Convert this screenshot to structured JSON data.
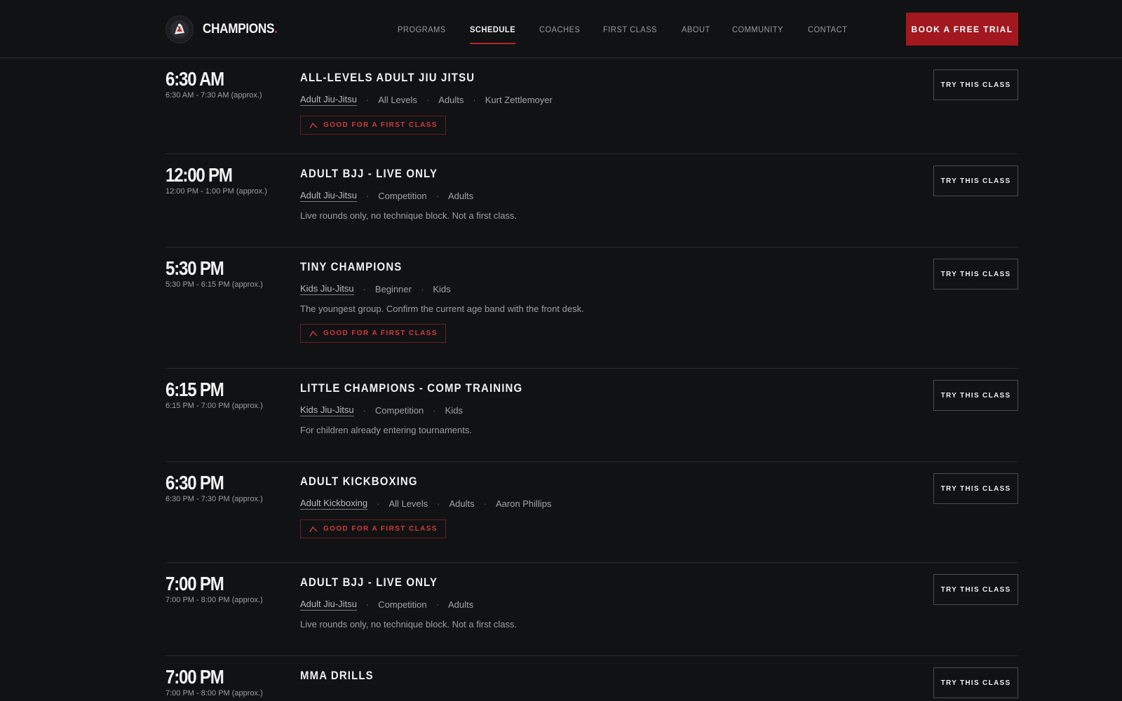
{
  "header": {
    "brand": "CHAMPIONS",
    "brand_dot": ".",
    "nav": [
      "PROGRAMS",
      "SCHEDULE",
      "COACHES",
      "FIRST CLASS",
      "ABOUT",
      "COMMUNITY",
      "CONTACT"
    ],
    "active_nav": "SCHEDULE",
    "cta": "BOOK A FREE TRIAL"
  },
  "colors": {
    "accent": "#a3181f",
    "badge": "#d13b3d",
    "background": "#111214"
  },
  "badge_label": "GOOD FOR A FIRST CLASS",
  "try_label": "TRY THIS CLASS",
  "classes": [
    {
      "time": "6:30 AM",
      "range": "6:30 AM - 7:30 AM (approx.)",
      "title": "ALL-LEVELS ADULT JIU JITSU",
      "program": "Adult Jiu-Jitsu",
      "tags": [
        "All Levels",
        "Adults",
        "Kurt Zettlemoyer"
      ],
      "description": "",
      "first_class": true
    },
    {
      "time": "12:00 PM",
      "range": "12:00 PM - 1:00 PM (approx.)",
      "title": "ADULT BJJ - LIVE ONLY",
      "program": "Adult Jiu-Jitsu",
      "tags": [
        "Competition",
        "Adults"
      ],
      "description": "Live rounds only, no technique block. Not a first class.",
      "first_class": false
    },
    {
      "time": "5:30 PM",
      "range": "5:30 PM - 6:15 PM (approx.)",
      "title": "TINY CHAMPIONS",
      "program": "Kids Jiu-Jitsu",
      "tags": [
        "Beginner",
        "Kids"
      ],
      "description": "The youngest group. Confirm the current age band with the front desk.",
      "first_class": true
    },
    {
      "time": "6:15 PM",
      "range": "6:15 PM - 7:00 PM (approx.)",
      "title": "LITTLE CHAMPIONS - COMP TRAINING",
      "program": "Kids Jiu-Jitsu",
      "tags": [
        "Competition",
        "Kids"
      ],
      "description": "For children already entering tournaments.",
      "first_class": false
    },
    {
      "time": "6:30 PM",
      "range": "6:30 PM - 7:30 PM (approx.)",
      "title": "ADULT KICKBOXING",
      "program": "Adult Kickboxing",
      "tags": [
        "All Levels",
        "Adults",
        "Aaron Phillips"
      ],
      "description": "",
      "first_class": true
    },
    {
      "time": "7:00 PM",
      "range": "7:00 PM - 8:00 PM (approx.)",
      "title": "ADULT BJJ - LIVE ONLY",
      "program": "Adult Jiu-Jitsu",
      "tags": [
        "Competition",
        "Adults"
      ],
      "description": "Live rounds only, no technique block. Not a first class.",
      "first_class": false
    },
    {
      "time": "7:00 PM",
      "range": "7:00 PM - 8:00 PM (approx.)",
      "title": "MMA DRILLS",
      "program": "",
      "tags": [],
      "description": "",
      "first_class": false
    }
  ]
}
